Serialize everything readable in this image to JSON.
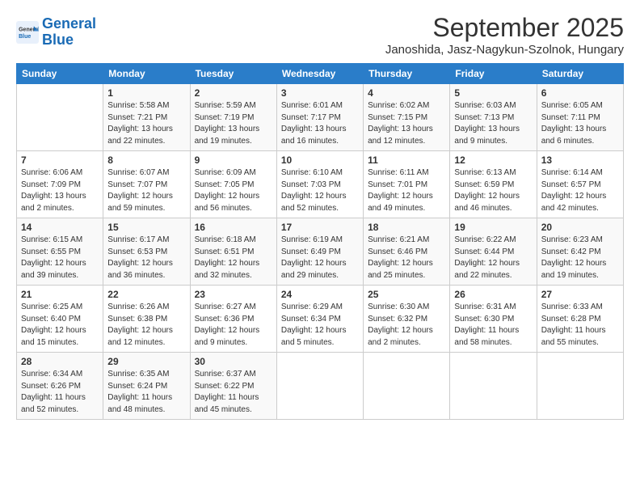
{
  "header": {
    "logo_line1": "General",
    "logo_line2": "Blue",
    "month": "September 2025",
    "location": "Janoshida, Jasz-Nagykun-Szolnok, Hungary"
  },
  "weekdays": [
    "Sunday",
    "Monday",
    "Tuesday",
    "Wednesday",
    "Thursday",
    "Friday",
    "Saturday"
  ],
  "weeks": [
    [
      {
        "day": "",
        "info": ""
      },
      {
        "day": "1",
        "info": "Sunrise: 5:58 AM\nSunset: 7:21 PM\nDaylight: 13 hours\nand 22 minutes."
      },
      {
        "day": "2",
        "info": "Sunrise: 5:59 AM\nSunset: 7:19 PM\nDaylight: 13 hours\nand 19 minutes."
      },
      {
        "day": "3",
        "info": "Sunrise: 6:01 AM\nSunset: 7:17 PM\nDaylight: 13 hours\nand 16 minutes."
      },
      {
        "day": "4",
        "info": "Sunrise: 6:02 AM\nSunset: 7:15 PM\nDaylight: 13 hours\nand 12 minutes."
      },
      {
        "day": "5",
        "info": "Sunrise: 6:03 AM\nSunset: 7:13 PM\nDaylight: 13 hours\nand 9 minutes."
      },
      {
        "day": "6",
        "info": "Sunrise: 6:05 AM\nSunset: 7:11 PM\nDaylight: 13 hours\nand 6 minutes."
      }
    ],
    [
      {
        "day": "7",
        "info": "Sunrise: 6:06 AM\nSunset: 7:09 PM\nDaylight: 13 hours\nand 2 minutes."
      },
      {
        "day": "8",
        "info": "Sunrise: 6:07 AM\nSunset: 7:07 PM\nDaylight: 12 hours\nand 59 minutes."
      },
      {
        "day": "9",
        "info": "Sunrise: 6:09 AM\nSunset: 7:05 PM\nDaylight: 12 hours\nand 56 minutes."
      },
      {
        "day": "10",
        "info": "Sunrise: 6:10 AM\nSunset: 7:03 PM\nDaylight: 12 hours\nand 52 minutes."
      },
      {
        "day": "11",
        "info": "Sunrise: 6:11 AM\nSunset: 7:01 PM\nDaylight: 12 hours\nand 49 minutes."
      },
      {
        "day": "12",
        "info": "Sunrise: 6:13 AM\nSunset: 6:59 PM\nDaylight: 12 hours\nand 46 minutes."
      },
      {
        "day": "13",
        "info": "Sunrise: 6:14 AM\nSunset: 6:57 PM\nDaylight: 12 hours\nand 42 minutes."
      }
    ],
    [
      {
        "day": "14",
        "info": "Sunrise: 6:15 AM\nSunset: 6:55 PM\nDaylight: 12 hours\nand 39 minutes."
      },
      {
        "day": "15",
        "info": "Sunrise: 6:17 AM\nSunset: 6:53 PM\nDaylight: 12 hours\nand 36 minutes."
      },
      {
        "day": "16",
        "info": "Sunrise: 6:18 AM\nSunset: 6:51 PM\nDaylight: 12 hours\nand 32 minutes."
      },
      {
        "day": "17",
        "info": "Sunrise: 6:19 AM\nSunset: 6:49 PM\nDaylight: 12 hours\nand 29 minutes."
      },
      {
        "day": "18",
        "info": "Sunrise: 6:21 AM\nSunset: 6:46 PM\nDaylight: 12 hours\nand 25 minutes."
      },
      {
        "day": "19",
        "info": "Sunrise: 6:22 AM\nSunset: 6:44 PM\nDaylight: 12 hours\nand 22 minutes."
      },
      {
        "day": "20",
        "info": "Sunrise: 6:23 AM\nSunset: 6:42 PM\nDaylight: 12 hours\nand 19 minutes."
      }
    ],
    [
      {
        "day": "21",
        "info": "Sunrise: 6:25 AM\nSunset: 6:40 PM\nDaylight: 12 hours\nand 15 minutes."
      },
      {
        "day": "22",
        "info": "Sunrise: 6:26 AM\nSunset: 6:38 PM\nDaylight: 12 hours\nand 12 minutes."
      },
      {
        "day": "23",
        "info": "Sunrise: 6:27 AM\nSunset: 6:36 PM\nDaylight: 12 hours\nand 9 minutes."
      },
      {
        "day": "24",
        "info": "Sunrise: 6:29 AM\nSunset: 6:34 PM\nDaylight: 12 hours\nand 5 minutes."
      },
      {
        "day": "25",
        "info": "Sunrise: 6:30 AM\nSunset: 6:32 PM\nDaylight: 12 hours\nand 2 minutes."
      },
      {
        "day": "26",
        "info": "Sunrise: 6:31 AM\nSunset: 6:30 PM\nDaylight: 11 hours\nand 58 minutes."
      },
      {
        "day": "27",
        "info": "Sunrise: 6:33 AM\nSunset: 6:28 PM\nDaylight: 11 hours\nand 55 minutes."
      }
    ],
    [
      {
        "day": "28",
        "info": "Sunrise: 6:34 AM\nSunset: 6:26 PM\nDaylight: 11 hours\nand 52 minutes."
      },
      {
        "day": "29",
        "info": "Sunrise: 6:35 AM\nSunset: 6:24 PM\nDaylight: 11 hours\nand 48 minutes."
      },
      {
        "day": "30",
        "info": "Sunrise: 6:37 AM\nSunset: 6:22 PM\nDaylight: 11 hours\nand 45 minutes."
      },
      {
        "day": "",
        "info": ""
      },
      {
        "day": "",
        "info": ""
      },
      {
        "day": "",
        "info": ""
      },
      {
        "day": "",
        "info": ""
      }
    ]
  ]
}
